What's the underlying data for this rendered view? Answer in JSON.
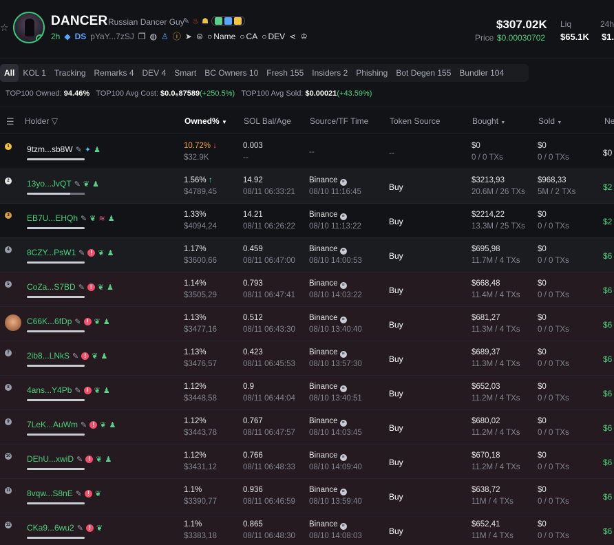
{
  "token": {
    "name": "DANCER",
    "subtitle": "Russian Dancer Guy",
    "age": "2h",
    "ds": "DS",
    "address": "pYaY...7zSJ",
    "name_search": "Name",
    "ca_search": "CA",
    "dev_search": "DEV"
  },
  "stats": {
    "market_cap": "$307.02K",
    "price_label": "Price",
    "price": "$0.00030702",
    "liq_label": "Liq",
    "liq": "$65.1K",
    "h24_label": "24h",
    "h24": "$1."
  },
  "tabs": [
    "All",
    "KOL 1",
    "Tracking",
    "Remarks 4",
    "DEV 4",
    "Smart",
    "BC Owners 10",
    "Fresh 155",
    "Insiders 2",
    "Phishing",
    "Bot Degen 155",
    "Bundler 104"
  ],
  "summary": {
    "owned_label": "TOP100 Owned:",
    "owned": "94.46%",
    "avg_cost_label": "TOP100 Avg Cost:",
    "avg_cost": "$0.0₅87589",
    "avg_cost_change": "(+250.5%)",
    "avg_sold_label": "TOP100 Avg Sold:",
    "avg_sold": "$0.00021",
    "avg_sold_change": "(+43.59%)"
  },
  "columns": {
    "holder": "Holder",
    "owned": "Owned%",
    "sol": "SOL Bal/Age",
    "source": "Source/TF Time",
    "token_source": "Token Source",
    "bought": "Bought",
    "sold": "Sold",
    "net": "Ne"
  },
  "rows": [
    {
      "rank": "1",
      "name": "9tzm...sb8W",
      "owned": "10.72%",
      "owned_usd": "$32.9K",
      "sol": "0.003",
      "age": "--",
      "source": "--",
      "source_time": "",
      "token_source": "--",
      "bought": "$0",
      "bought_sub": "0 / 0 TXs",
      "sold": "$0",
      "sold_sub": "0 / 0 TXs",
      "net": "$0",
      "bar": 1.0
    },
    {
      "rank": "2",
      "name": "13yo...JvQT",
      "owned": "1.56%",
      "owned_usd": "$4789,45",
      "sol": "14.92",
      "age": "08/11 06:33:21",
      "source": "Binance",
      "source_time": "08/10 11:16:45",
      "token_source": "Buy",
      "bought": "$3213,93",
      "bought_sub": "20.6M / 26 TXs",
      "sold": "$968,33",
      "sold_sub": "5M / 2 TXs",
      "net": "$2",
      "bar": 0.75
    },
    {
      "rank": "3",
      "name": "EB7U...EHQh",
      "owned": "1.33%",
      "owned_usd": "$4094,24",
      "sol": "14.21",
      "age": "08/11 06:26:22",
      "source": "Binance",
      "source_time": "08/10 11:13:22",
      "token_source": "Buy",
      "bought": "$2214,22",
      "bought_sub": "13.3M / 25 TXs",
      "sold": "$0",
      "sold_sub": "0 / 0 TXs",
      "net": "$2",
      "bar": 1.0
    },
    {
      "rank": "4",
      "name": "8CZY...PsW1",
      "owned": "1.17%",
      "owned_usd": "$3600,66",
      "sol": "0.459",
      "age": "08/11 06:47:00",
      "source": "Binance",
      "source_time": "08/10 14:00:53",
      "token_source": "Buy",
      "bought": "$695,98",
      "bought_sub": "11.7M / 4 TXs",
      "sold": "$0",
      "sold_sub": "0 / 0 TXs",
      "net": "$6",
      "bar": 1.0
    },
    {
      "rank": "5",
      "name": "CoZa...S7BD",
      "owned": "1.14%",
      "owned_usd": "$3505,29",
      "sol": "0.793",
      "age": "08/11 06:47:41",
      "source": "Binance",
      "source_time": "08/10 14:03:22",
      "token_source": "Buy",
      "bought": "$668,48",
      "bought_sub": "11.4M / 4 TXs",
      "sold": "$0",
      "sold_sub": "0 / 0 TXs",
      "net": "$6",
      "bar": 1.0
    },
    {
      "rank": "6",
      "name": "C66K...6fDp",
      "owned": "1.13%",
      "owned_usd": "$3477,16",
      "sol": "0.512",
      "age": "08/11 06:43:30",
      "source": "Binance",
      "source_time": "08/10 13:40:40",
      "token_source": "Buy",
      "bought": "$681,27",
      "bought_sub": "11.3M / 4 TXs",
      "sold": "$0",
      "sold_sub": "0 / 0 TXs",
      "net": "$6",
      "bar": 1.0
    },
    {
      "rank": "7",
      "name": "2ib8...LNkS",
      "owned": "1.13%",
      "owned_usd": "$3476,57",
      "sol": "0.423",
      "age": "08/11 06:45:53",
      "source": "Binance",
      "source_time": "08/10 13:57:30",
      "token_source": "Buy",
      "bought": "$689,37",
      "bought_sub": "11.3M / 4 TXs",
      "sold": "$0",
      "sold_sub": "0 / 0 TXs",
      "net": "$6",
      "bar": 1.0
    },
    {
      "rank": "8",
      "name": "4ans...Y4Pb",
      "owned": "1.12%",
      "owned_usd": "$3448,58",
      "sol": "0.9",
      "age": "08/11 06:44:04",
      "source": "Binance",
      "source_time": "08/10 13:40:51",
      "token_source": "Buy",
      "bought": "$652,03",
      "bought_sub": "11.2M / 4 TXs",
      "sold": "$0",
      "sold_sub": "0 / 0 TXs",
      "net": "$6",
      "bar": 1.0
    },
    {
      "rank": "9",
      "name": "7LeK...AuWm",
      "owned": "1.12%",
      "owned_usd": "$3443,78",
      "sol": "0.767",
      "age": "08/11 06:47:57",
      "source": "Binance",
      "source_time": "08/10 14:03:45",
      "token_source": "Buy",
      "bought": "$680,02",
      "bought_sub": "11.2M / 4 TXs",
      "sold": "$0",
      "sold_sub": "0 / 0 TXs",
      "net": "$6",
      "bar": 1.0
    },
    {
      "rank": "10",
      "name": "DEhU...xwiD",
      "owned": "1.12%",
      "owned_usd": "$3431,12",
      "sol": "0.766",
      "age": "08/11 06:48:33",
      "source": "Binance",
      "source_time": "08/10 14:09:40",
      "token_source": "Buy",
      "bought": "$670,18",
      "bought_sub": "11.2M / 4 TXs",
      "sold": "$0",
      "sold_sub": "0 / 0 TXs",
      "net": "$6",
      "bar": 1.0
    },
    {
      "rank": "11",
      "name": "8vqw...S8nE",
      "owned": "1.1%",
      "owned_usd": "$3390,77",
      "sol": "0.936",
      "age": "08/11 06:46:59",
      "source": "Binance",
      "source_time": "08/10 13:59:40",
      "token_source": "Buy",
      "bought": "$638,72",
      "bought_sub": "11M / 4 TXs",
      "sold": "$0",
      "sold_sub": "0 / 0 TXs",
      "net": "$6",
      "bar": 1.0
    },
    {
      "rank": "12",
      "name": "CKa9...6wu2",
      "owned": "1.1%",
      "owned_usd": "$3383,18",
      "sol": "0.865",
      "age": "08/11 06:48:30",
      "source": "Binance",
      "source_time": "08/10 14:08:03",
      "token_source": "Buy",
      "bought": "$652,41",
      "bought_sub": "11M / 4 TXs",
      "sold": "$0",
      "sold_sub": "0 / 0 TXs",
      "net": "$6",
      "bar": 1.0
    }
  ]
}
